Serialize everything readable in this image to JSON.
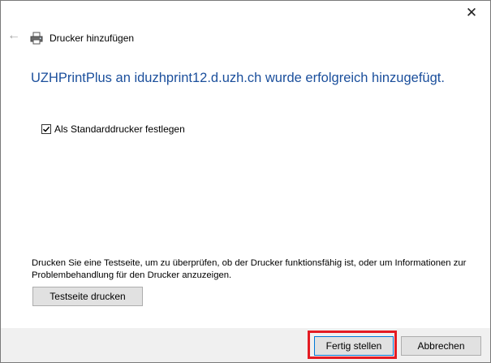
{
  "window": {
    "close_glyph": "✕"
  },
  "header": {
    "back_glyph": "←",
    "title": "Drucker hinzufügen",
    "icon": "printer-icon"
  },
  "main": {
    "headline": "UZHPrintPlus an iduzhprint12.d.uzh.ch wurde erfolgreich hinzugefügt.",
    "default_checkbox": {
      "label": "Als Standarddrucker festlegen",
      "checked": true
    },
    "info_text": "Drucken Sie eine Testseite, um zu überprüfen, ob der Drucker funktionsfähig ist, oder um Informationen zur Problembehandlung für den Drucker anzuzeigen.",
    "test_button_label": "Testseite drucken"
  },
  "footer": {
    "finish_label": "Fertig stellen",
    "cancel_label": "Abbrechen"
  },
  "colors": {
    "headline": "#1b4f9c",
    "highlight": "#e41b23",
    "focus": "#0078d7"
  }
}
